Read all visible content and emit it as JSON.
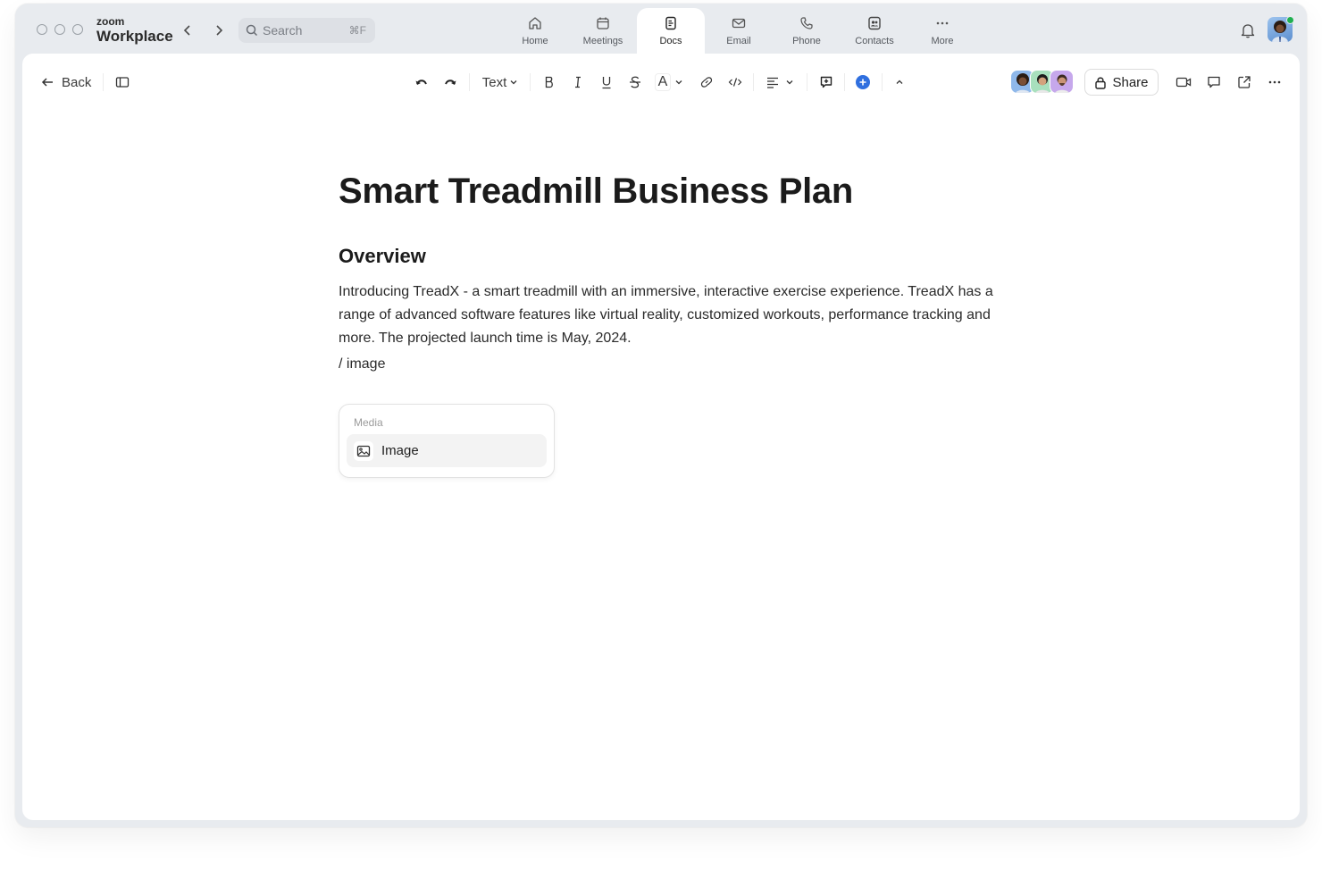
{
  "window": {
    "brand_small": "zoom",
    "brand_big": "Workplace",
    "search_placeholder": "Search",
    "search_shortcut": "⌘F",
    "tabs": [
      {
        "label": "Home",
        "icon": "home-icon"
      },
      {
        "label": "Meetings",
        "icon": "calendar-icon"
      },
      {
        "label": "Docs",
        "icon": "docs-icon",
        "active": true
      },
      {
        "label": "Email",
        "icon": "mail-icon"
      },
      {
        "label": "Phone",
        "icon": "phone-icon"
      },
      {
        "label": "Contacts",
        "icon": "contacts-icon"
      },
      {
        "label": "More",
        "icon": "more-icon"
      }
    ],
    "status_color": "#1fb050"
  },
  "toolbar": {
    "back_label": "Back",
    "text_style": "Text",
    "font_color_label": "A",
    "share_label": "Share",
    "accent": "#2f6fdf"
  },
  "document": {
    "title": "Smart Treadmill Business Plan",
    "heading": "Overview",
    "paragraph": "Introducing TreadX - a smart treadmill with an immersive, interactive exercise experience. TreadX has a range of advanced software features like virtual reality, customized workouts, performance tracking and more. The projected launch time is May, 2024.",
    "slash_command": "/ image"
  },
  "slash_menu": {
    "section": "Media",
    "items": [
      {
        "label": "Image",
        "icon": "image-icon"
      }
    ]
  }
}
